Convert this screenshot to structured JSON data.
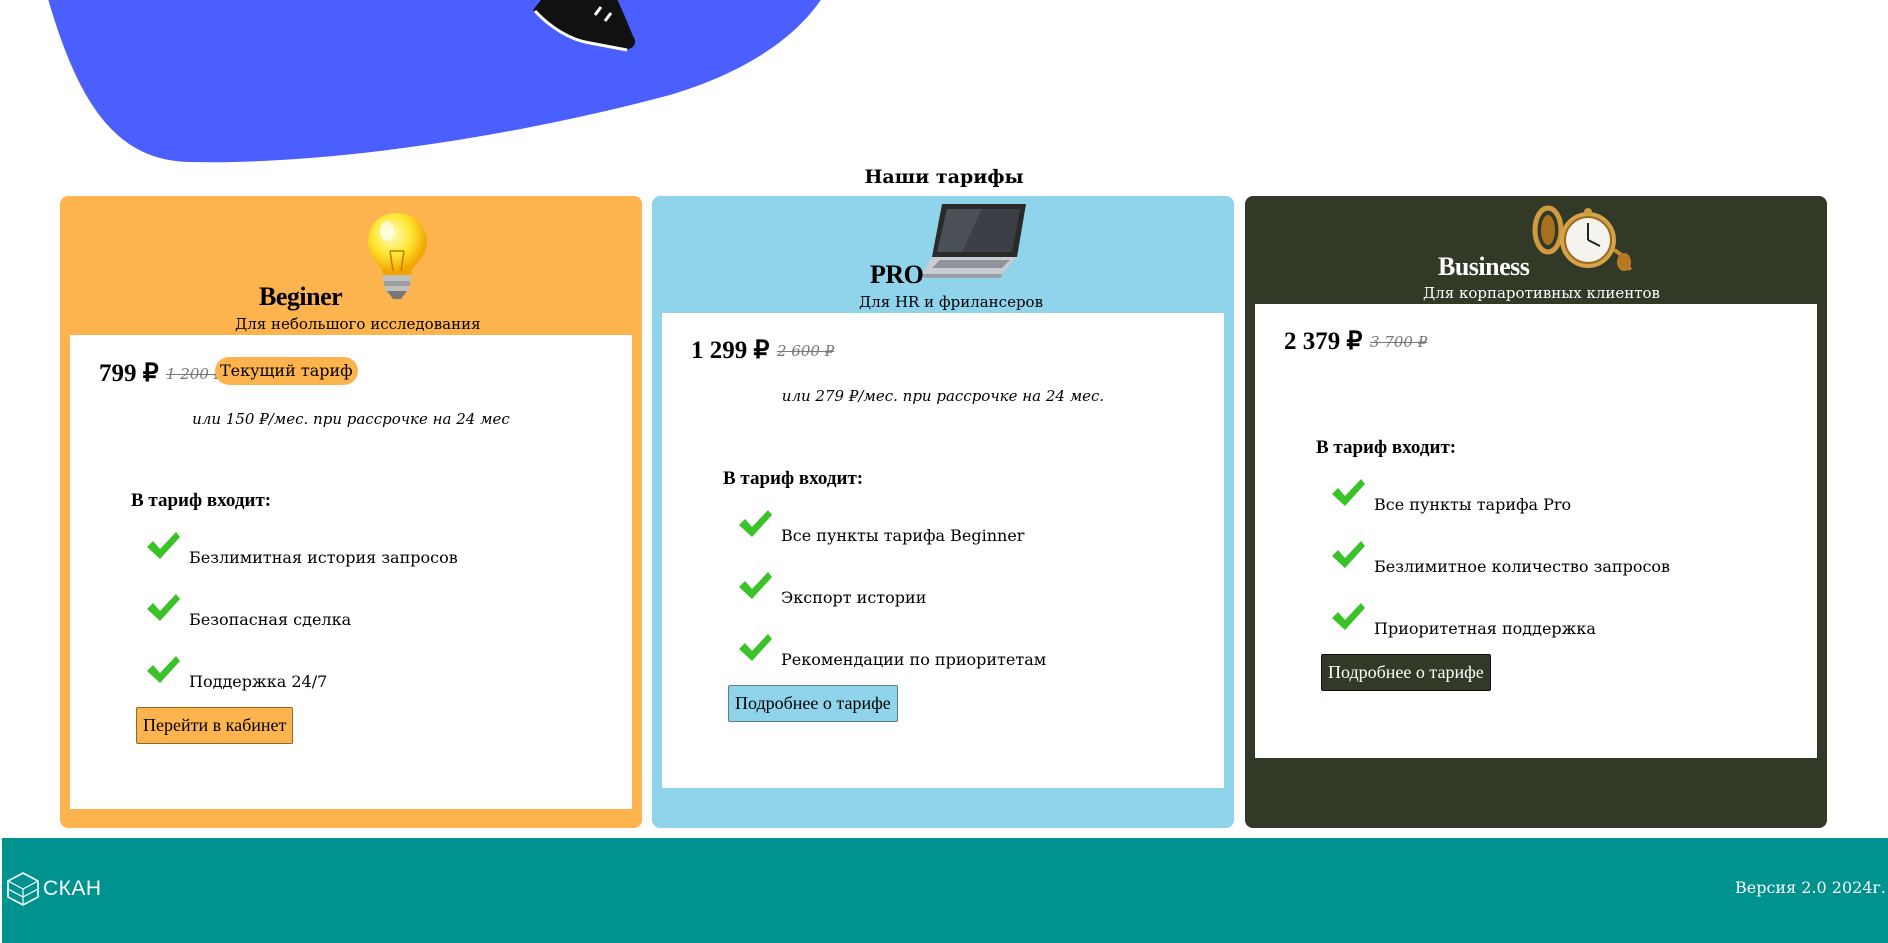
{
  "colors": {
    "orange": "#fdb44e",
    "blue": "#8fd4ea",
    "dark": "#323a27",
    "hero_blob": "#4a5ffe",
    "footer": "#00928f",
    "check_green": "#3bc229"
  },
  "tariffs_title": "Наши тарифы",
  "plans": [
    {
      "name": "Beginer",
      "subtitle": "Для небольшого исследования",
      "icon": "lightbulb-icon",
      "price": "799 ₽",
      "old_price": "1 200 ₽",
      "badge": "Текущий тариф",
      "installment": "или 150 ₽/мес. при рассрочке на 24 мес",
      "includes_title": "В тариф входит:",
      "features": [
        "Безлимитная история запросов",
        "Безопасная сделка",
        "Поддержка 24/7"
      ],
      "button": "Перейти в кабинет"
    },
    {
      "name": "PRO",
      "subtitle": "Для HR и фрилансеров",
      "icon": "laptop-icon",
      "price": "1 299 ₽",
      "old_price": "2 600 ₽",
      "installment": "или 279 ₽/мес. при рассрочке на 24 мес.",
      "includes_title": "В тариф входит:",
      "features": [
        "Все пункты тарифа Beginner",
        "Экспорт истории",
        "Рекомендации по приоритетам"
      ],
      "button": "Подробнее о тарифе"
    },
    {
      "name": "Business",
      "subtitle": "Для корпаротивных клиентов",
      "icon": "pocket-watch-icon",
      "price": "2 379 ₽",
      "old_price": "3 700 ₽",
      "includes_title": "В тариф входит:",
      "features": [
        "Все пункты тарифа Pro",
        "Безлимитное количество запросов",
        "Приоритетная поддержка"
      ],
      "button": "Подробнее о тарифе"
    }
  ],
  "footer": {
    "logo_text": "СКАН",
    "version": "Версия 2.0 2024г."
  }
}
